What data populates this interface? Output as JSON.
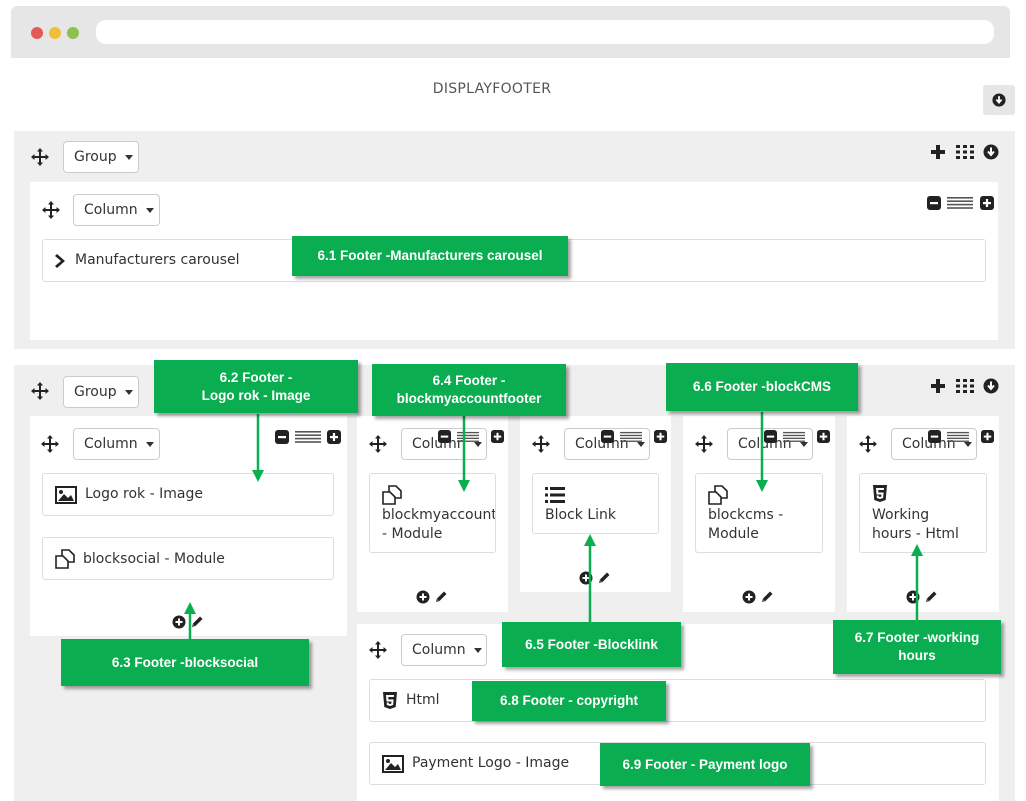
{
  "page": {
    "title": "DISPLAYFOOTER"
  },
  "group_label": "Group",
  "column_label": "Column",
  "group1": {
    "modules": [
      {
        "label": "Manufacturers carousel",
        "icon": "chevron-right-icon"
      }
    ]
  },
  "group2": {
    "col1": [
      {
        "label": "Logo rok - Image",
        "icon": "image-icon"
      },
      {
        "label": "blocksocial - Module",
        "icon": "module-icon"
      }
    ],
    "col2": {
      "line1": "blockmyaccountfooter",
      "line2": "- Module",
      "icon": "module-icon"
    },
    "col3": {
      "line1": "Block Link",
      "icon": "list-icon"
    },
    "col4": {
      "line1": "blockcms -",
      "line2": "Module",
      "icon": "module-icon"
    },
    "col5": {
      "line1": "Working",
      "line2": "hours - Html",
      "icon": "html5-icon"
    },
    "col6": [
      {
        "label": "Html",
        "icon": "html5-icon"
      },
      {
        "label": "Payment Logo - Image",
        "icon": "image-icon"
      }
    ]
  },
  "callouts": {
    "c61": "6.1 Footer -Manufacturers carousel",
    "c62a": "6.2 Footer -",
    "c62b": "Logo rok - Image",
    "c63": "6.3 Footer -blocksocial",
    "c64a": "6.4 Footer -",
    "c64b": "blockmyaccountfooter",
    "c65": "6.5 Footer -Blocklink",
    "c66": "6.6 Footer -blockCMS",
    "c67a": "6.7 Footer -working",
    "c67b": "hours",
    "c68": "6.8 Footer - copyright",
    "c69": "6.9 Footer - Payment logo"
  },
  "colors": {
    "callout": "#0bad51",
    "group_bg": "#efefef"
  }
}
